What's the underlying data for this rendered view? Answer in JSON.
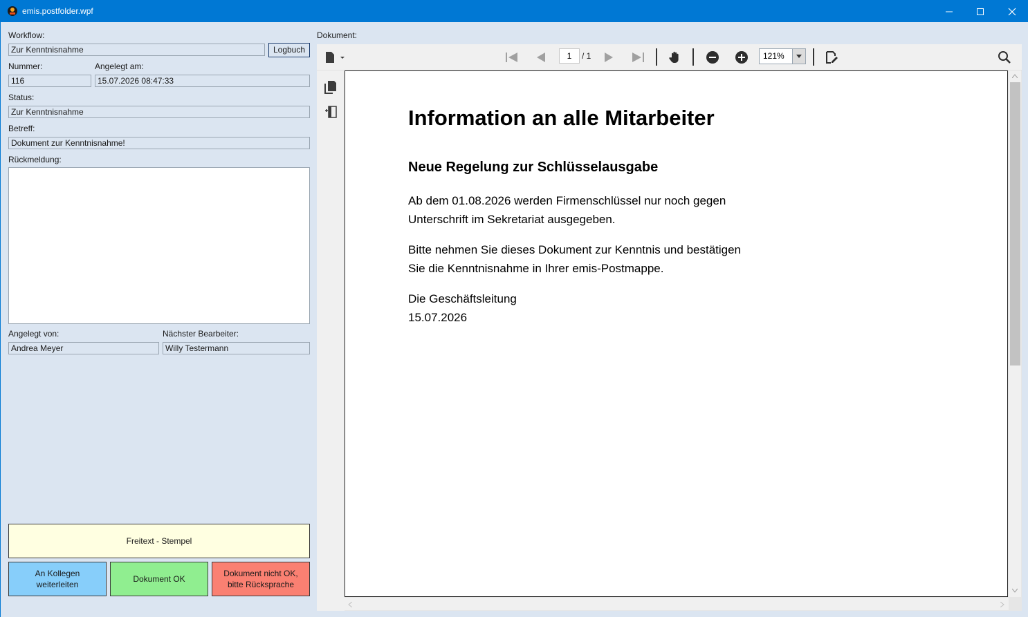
{
  "window": {
    "title": "emis.postfolder.wpf"
  },
  "form": {
    "workflow_label": "Workflow:",
    "workflow_value": "Zur Kenntnisnahme",
    "logbuch_label": "Logbuch",
    "nummer_label": "Nummer:",
    "nummer_value": "116",
    "angelegt_am_label": "Angelegt am:",
    "angelegt_am_value": "15.07.2026 08:47:33",
    "status_label": "Status:",
    "status_value": "Zur Kenntnisnahme",
    "betreff_label": "Betreff:",
    "betreff_value": "Dokument zur Kenntnisnahme!",
    "rueckmeldung_label": "Rückmeldung:",
    "rueckmeldung_value": "",
    "angelegt_von_label": "Angelegt von:",
    "angelegt_von_value": "Andrea Meyer",
    "naechster_label": "Nächster Bearbeiter:",
    "naechster_value": "Willy Testermann"
  },
  "actions": {
    "freitext_label": "Freitext - Stempel",
    "forward_label_1": "An Kollegen",
    "forward_label_2": "weiterleiten",
    "ok_label": "Dokument OK",
    "notok_label_1": "Dokument nicht OK,",
    "notok_label_2": "bitte Rücksprache",
    "colors": {
      "freitext": "#ffffe1",
      "forward": "#87cefa",
      "ok": "#90ee90",
      "notok": "#fa8072"
    }
  },
  "viewer": {
    "label": "Dokument:",
    "page_current": "1",
    "page_total": "/ 1",
    "zoom": "121%"
  },
  "document": {
    "heading": "Information an alle Mitarbeiter",
    "subheading": "Neue Regelung zur Schlüsselausgabe",
    "para1_line1": "Ab dem 01.08.2026 werden Firmenschlüssel nur noch gegen",
    "para1_line2": "Unterschrift im Sekretariat ausgegeben.",
    "para2_line1": "Bitte nehmen Sie dieses Dokument zur Kenntnis und bestätigen",
    "para2_line2": "Sie die Kenntnisnahme in Ihrer emis-Postmappe.",
    "sign_line1": "Die Geschäftsleitung",
    "sign_line2": "15.07.2026"
  }
}
